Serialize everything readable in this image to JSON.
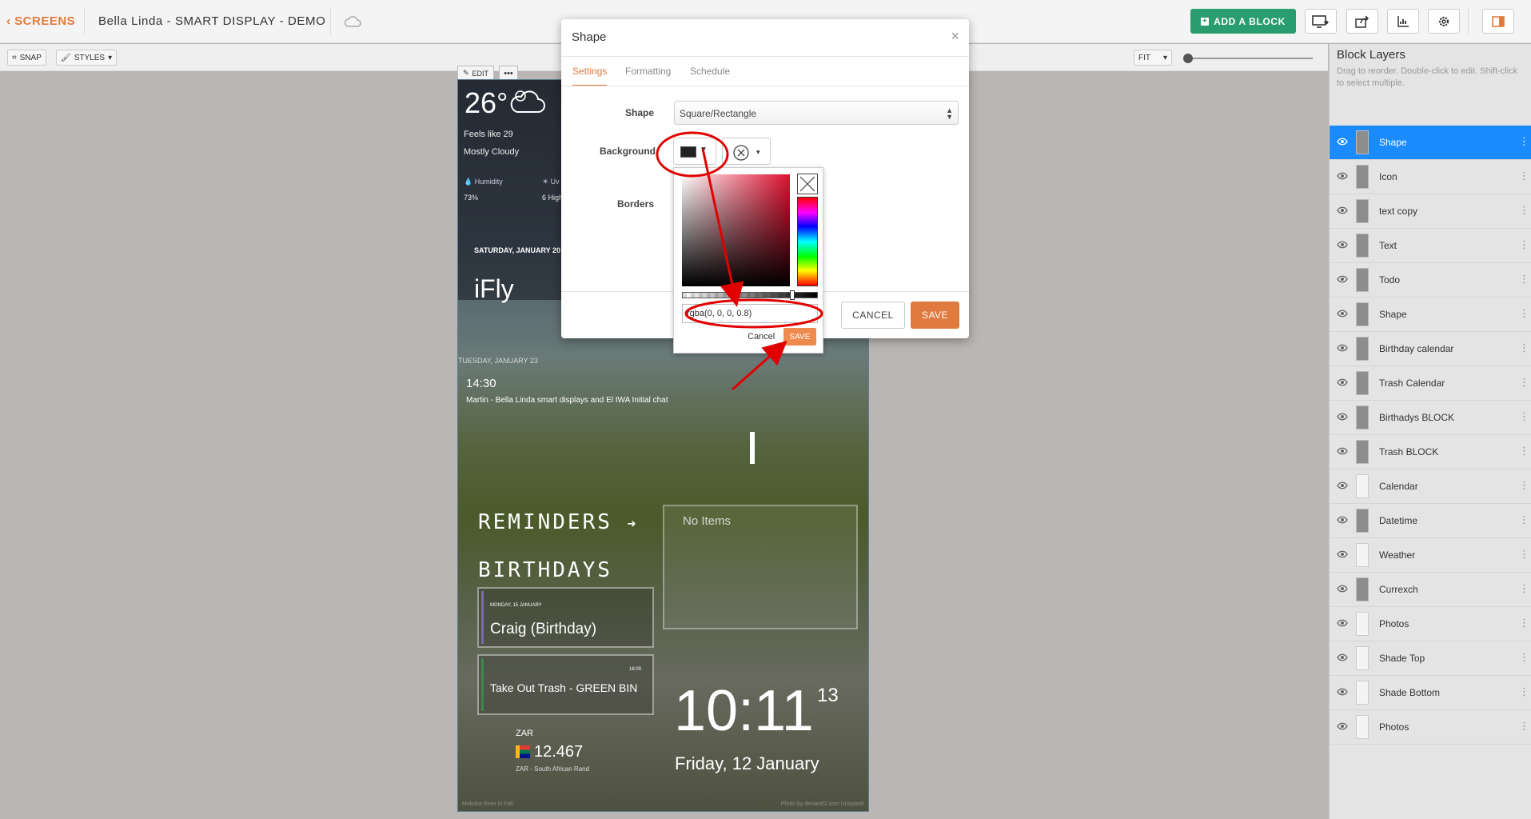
{
  "header": {
    "back_label": "SCREENS",
    "title": "Bella Linda - SMART DISPLAY - DEMO",
    "add_block_label": "ADD A BLOCK"
  },
  "toolbar": {
    "snap_label": "SNAP",
    "styles_label": "STYLES",
    "fit_label": "FIT"
  },
  "block_controls": {
    "edit_label": "EDIT",
    "more_label": "•••"
  },
  "preview": {
    "weather": {
      "temp": "26°",
      "feels_like": "Feels like 29",
      "condition": "Mostly Cloudy",
      "humidity_label": "Humidity",
      "humidity_value": "73%",
      "uv_label": "Uv",
      "uv_value": "6 High"
    },
    "calendar": {
      "date": "SATURDAY, JANUARY 20",
      "event": "iFly"
    },
    "todo": {
      "date": "TUESDAY, JANUARY 23",
      "time": "14:30",
      "text": "Martin - Bella Linda smart displays and El IWA Initial chat"
    },
    "reminders_heading": "REMINDERS",
    "birthdays_heading": "BIRTHDAYS",
    "no_items": "No Items",
    "events": [
      {
        "date": "MONDAY, 15 JANUARY",
        "title": "Craig (Birthday)"
      },
      {
        "date": "",
        "time": "18:00",
        "title": "Take Out Trash - GREEN BIN"
      }
    ],
    "currency": {
      "code": "ZAR",
      "value": "12.467",
      "name": "ZAR - South African Rand"
    },
    "clock": {
      "time": "10:11",
      "seconds": "13",
      "date": "Friday, 12 January"
    },
    "credits": {
      "left": "Mokoka River in Fall",
      "right": "Photo by deviantf2.com Unsplash"
    }
  },
  "modal": {
    "title": "Shape",
    "tabs": [
      "Settings",
      "Formatting",
      "Schedule"
    ],
    "shape_label": "Shape",
    "shape_value": "Square/Rectangle",
    "background_label": "Background",
    "borders_label": "Borders",
    "cancel_label": "CANCEL",
    "save_label": "SAVE"
  },
  "picker": {
    "value": "rgba(0, 0, 0, 0.8)",
    "cancel_label": "Cancel",
    "save_label": "SAVE"
  },
  "layers": {
    "title": "Block Layers",
    "help": "Drag to reorder. Double-click to edit. Shift-click to select multiple.",
    "items": [
      "Shape",
      "Icon",
      "text copy",
      "Text",
      "Todo",
      "Shape",
      "Birthday calendar",
      "Trash Calendar",
      "Birthadys BLOCK",
      "Trash BLOCK",
      "Calendar",
      "Datetime",
      "Weather",
      "Currexch",
      "Photos",
      "Shade Top",
      "Shade Bottom",
      "Photos"
    ]
  },
  "colors": {
    "accent": "#e07a3e",
    "add_block": "#2a9d6f",
    "selected_layer": "#1a8cff",
    "annotation": "#e00000"
  }
}
